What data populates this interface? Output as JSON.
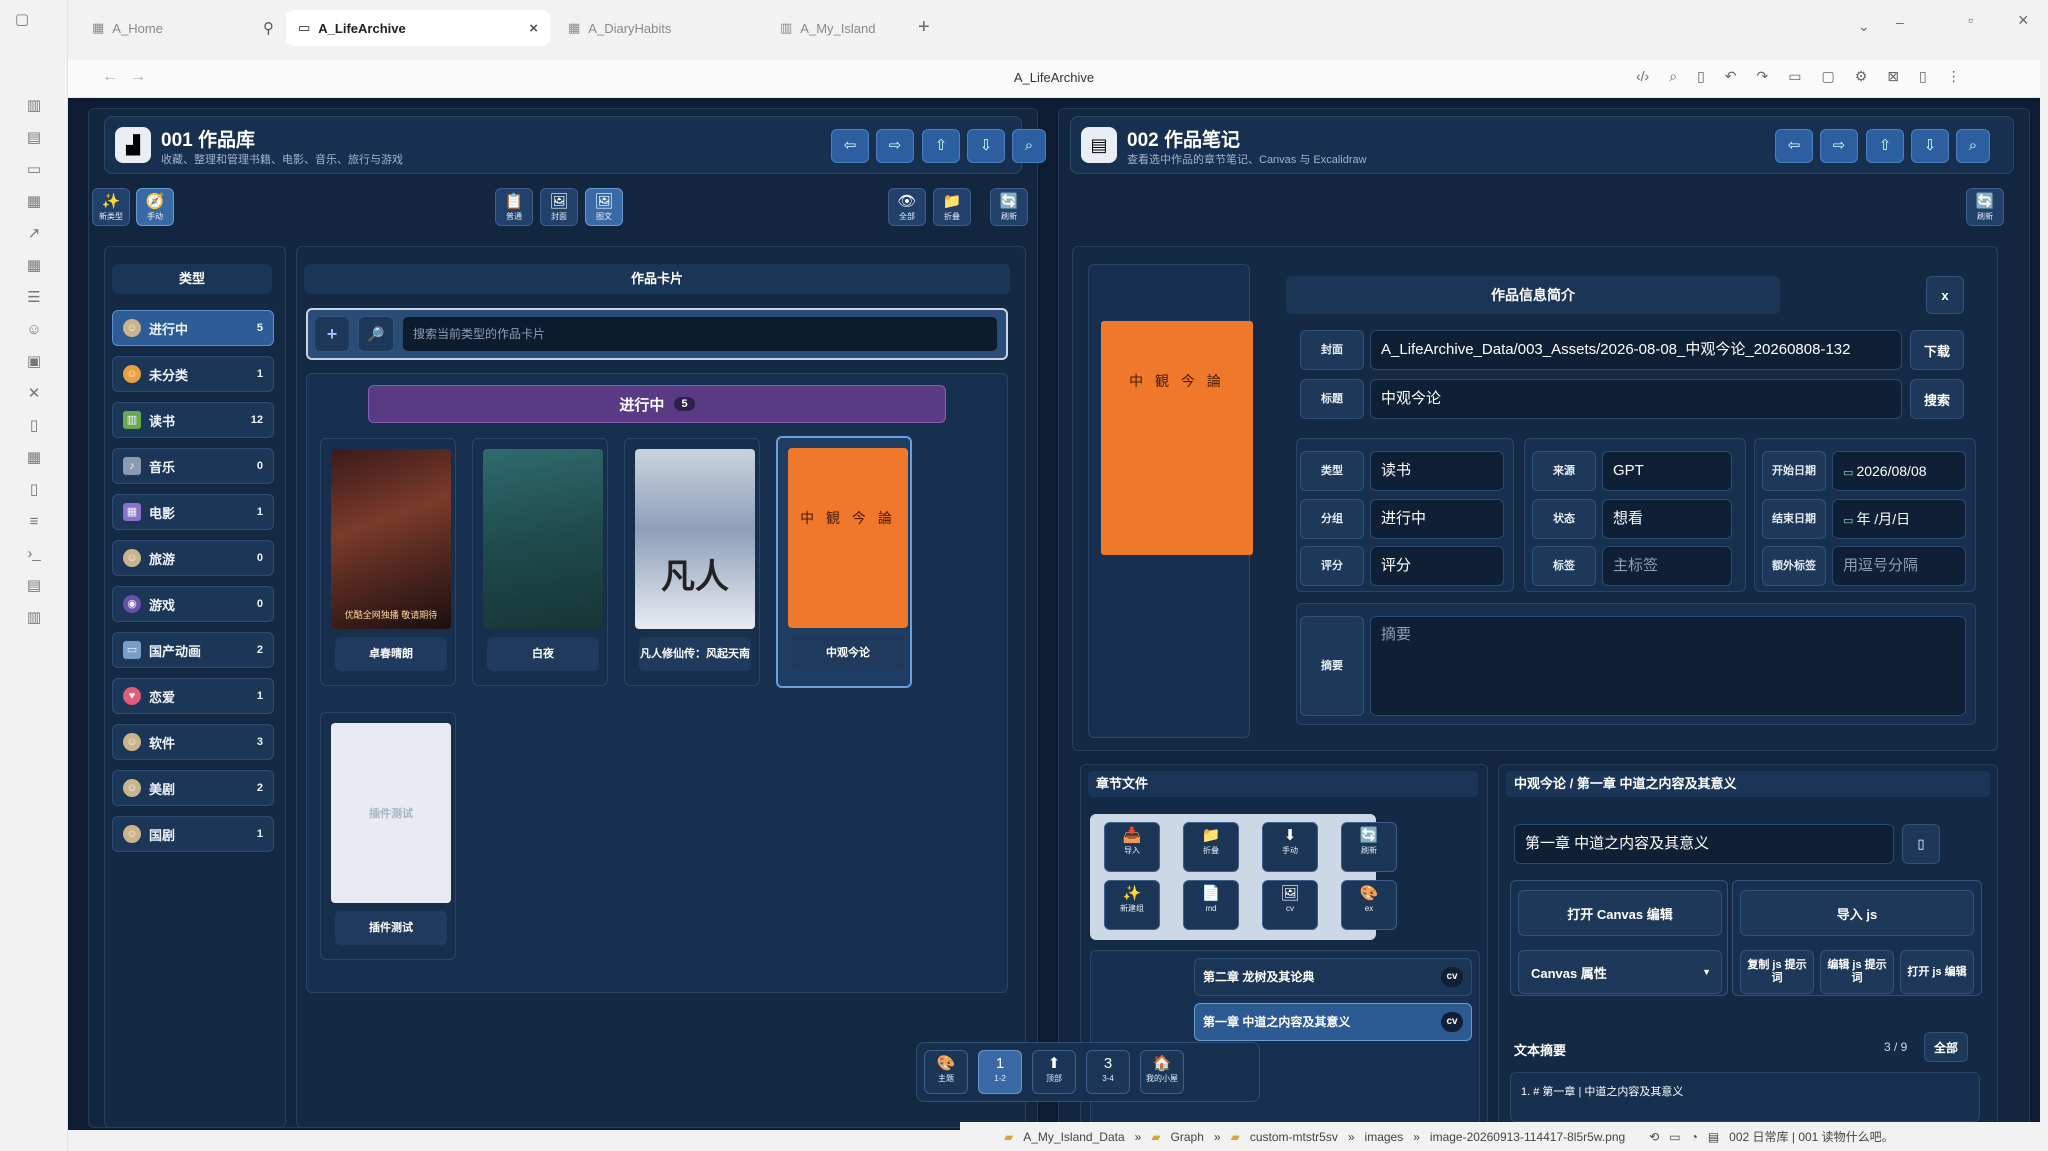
{
  "tabs": [
    {
      "label": "A_Home"
    },
    {
      "label": "A_LifeArchive"
    },
    {
      "label": "A_DiaryHabits"
    },
    {
      "label": "A_My_Island"
    }
  ],
  "window_title": "A_LifeArchive",
  "left": {
    "title": "001 作品库",
    "subtitle": "收藏、整理和管理书籍、电影、音乐、旅行与游戏",
    "tools": [
      {
        "icon": "✨",
        "label": "新类型"
      },
      {
        "icon": "🧭",
        "label": "手动"
      },
      {
        "icon": "📋",
        "label": "普通"
      },
      {
        "icon": "🖼",
        "label": "封面"
      },
      {
        "icon": "🖼",
        "label": "图文"
      },
      {
        "icon": "👁",
        "label": "全部"
      },
      {
        "icon": "📁",
        "label": "折叠"
      },
      {
        "icon": "🔄",
        "label": "刷新"
      }
    ],
    "cat_header": "类型",
    "cards_header": "作品卡片",
    "search_placeholder": "搜索当前类型的作品卡片",
    "categories": [
      {
        "label": "进行中",
        "count": "5"
      },
      {
        "label": "未分类",
        "count": "1"
      },
      {
        "label": "读书",
        "count": "12"
      },
      {
        "label": "音乐",
        "count": "0"
      },
      {
        "label": "电影",
        "count": "1"
      },
      {
        "label": "旅游",
        "count": "0"
      },
      {
        "label": "游戏",
        "count": "0"
      },
      {
        "label": "国产动画",
        "count": "2"
      },
      {
        "label": "恋爱",
        "count": "1"
      },
      {
        "label": "软件",
        "count": "3"
      },
      {
        "label": "美剧",
        "count": "2"
      },
      {
        "label": "国剧",
        "count": "1"
      }
    ],
    "group_label": "进行中",
    "group_count": "5",
    "cards": [
      {
        "title": "卓春晴朗"
      },
      {
        "title": "白夜"
      },
      {
        "title": "凡人修仙传：风起天南"
      },
      {
        "title": "中观今论"
      },
      {
        "title": "插件测试"
      }
    ],
    "poster_texts": {
      "p1": "优酷全网独播 敬请期待",
      "p3": "凡人",
      "p4": "中 観 今 論",
      "p5": "插件测试"
    }
  },
  "right": {
    "title": "002 作品笔记",
    "subtitle": "查看选中作品的章节笔记、Canvas 与 Excalidraw",
    "info_header": "作品信息简介",
    "close": "x",
    "cover_label": "封面",
    "cover_value": "A_LifeArchive_Data/003_Assets/2026-08-08_中观今论_20260808-132",
    "download": "下载",
    "title_label": "标题",
    "title_value": "中观今论",
    "search": "搜索",
    "type_label": "类型",
    "type_value": "读书",
    "source_label": "来源",
    "source_value": "GPT",
    "start_label": "开始日期",
    "start_value": "2026/08/08",
    "group_label": "分组",
    "group_value": "进行中",
    "state_label": "状态",
    "state_value": "想看",
    "end_label": "结束日期",
    "end_value": "年 /月/日",
    "rating_label": "评分",
    "rating_value": "评分",
    "tag_label": "标签",
    "tag_value": "主标签",
    "extra_label": "额外标签",
    "extra_value": "用逗号分隔",
    "summary_label": "摘要",
    "summary_placeholder": "摘要",
    "chapters_header": "章节文件",
    "chapter_tools": [
      {
        "icon": "📥",
        "label": "导入"
      },
      {
        "icon": "📁",
        "label": "折叠"
      },
      {
        "icon": "⬇",
        "label": "手动"
      },
      {
        "icon": "🔄",
        "label": "刷新"
      },
      {
        "icon": "✨",
        "label": "新建组"
      },
      {
        "icon": "📄",
        "label": "md"
      },
      {
        "icon": "🖼",
        "label": "cv"
      },
      {
        "icon": "🎨",
        "label": "ex"
      }
    ],
    "chapters": [
      {
        "title": "第二章 龙树及其论典",
        "tag": "cv"
      },
      {
        "title": "第一章 中道之内容及其意义",
        "tag": "cv"
      }
    ],
    "note_path": "中观今论 / 第一章 中道之内容及其意义",
    "note_name": "第一章 中道之内容及其意义",
    "open_canvas": "打开 Canvas 编辑",
    "import_js": "导入 js",
    "canvas_props": "Canvas 属性",
    "copy_js": "复制 js 提示词",
    "edit_js": "编辑 js 提示词",
    "open_js": "打开 js 编辑",
    "text_summary": "文本摘要",
    "pager": "3 / 9",
    "all": "全部",
    "line1": "1. # 第一章 | 中道之内容及其意义"
  },
  "dock": [
    {
      "icon": "🎨",
      "label": "主题"
    },
    {
      "icon": "1",
      "label": "1-2"
    },
    {
      "icon": "⬆",
      "label": "顶部"
    },
    {
      "icon": "3",
      "label": "3-4"
    },
    {
      "icon": "🏠",
      "label": "我的小屋"
    }
  ],
  "statusbar": {
    "crumbs": [
      "A_My_Island_Data",
      "Graph",
      "custom-mtstr5sv",
      "images",
      "image-20260913-114417-8l5r5w.png"
    ],
    "right": "002 日常库 | 001 读物什么吧。"
  }
}
